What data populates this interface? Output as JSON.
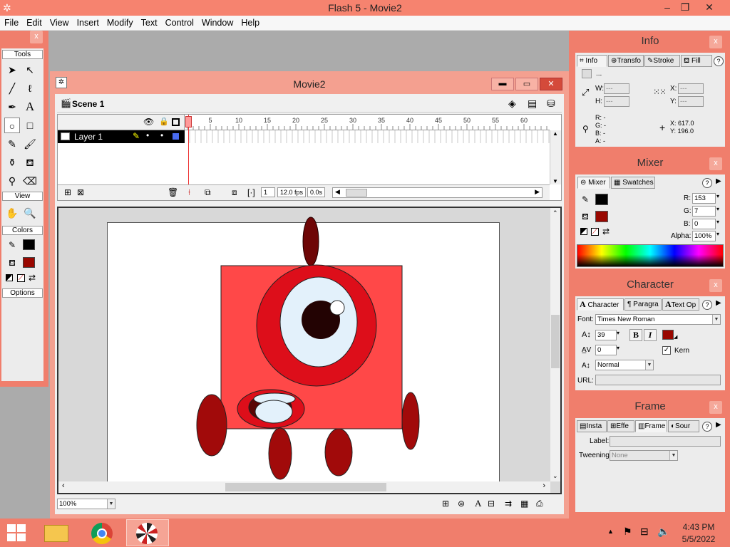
{
  "window": {
    "title": "Flash 5 - Movie2"
  },
  "menu": [
    "File",
    "Edit",
    "View",
    "Insert",
    "Modify",
    "Text",
    "Control",
    "Window",
    "Help"
  ],
  "tools": {
    "title": "Tools",
    "view_label": "View",
    "colors_label": "Colors",
    "options_label": "Options"
  },
  "movie": {
    "title": "Movie2",
    "scene": "Scene 1",
    "layer": "Layer 1",
    "ruler": [
      "1",
      "5",
      "10",
      "15",
      "20",
      "25",
      "30",
      "35",
      "40",
      "45",
      "50",
      "55",
      "60"
    ],
    "frame": "1",
    "fps": "12.0 fps",
    "time": "0.0s",
    "zoom": "100%"
  },
  "info_panel": {
    "title": "Info",
    "tabs": [
      "Info",
      "Transfo",
      "Stroke",
      "Fill"
    ],
    "w_label": "W:",
    "w_value": "---",
    "h_label": "H:",
    "h_value": "---",
    "x_label": "X:",
    "x_value": "---",
    "y_label": "Y:",
    "y_value": "---",
    "r_line": "R: -",
    "g_line": "G: -",
    "b_line": "B: -",
    "a_line": "A: -",
    "cursor_x": "X:  617.0",
    "cursor_y": "Y:  196.0"
  },
  "mixer_panel": {
    "title": "Mixer",
    "tabs": [
      "Mixer",
      "Swatches"
    ],
    "r_label": "R:",
    "r_value": "153",
    "g_label": "G:",
    "g_value": "7",
    "b_label": "B:",
    "b_value": "0",
    "alpha_label": "Alpha:",
    "alpha_value": "100%"
  },
  "character_panel": {
    "title": "Character",
    "tabs": [
      "Character",
      "Paragra",
      "Text Op"
    ],
    "font_label": "Font:",
    "font_value": "Times New Roman",
    "size_value": "39",
    "bold": "B",
    "italic": "I",
    "tracking_value": "0",
    "kern_label": "Kern",
    "baseline_value": "Normal",
    "url_label": "URL:"
  },
  "frame_panel": {
    "title": "Frame",
    "tabs": [
      "Insta",
      "Effe",
      "Frame",
      "Sour"
    ],
    "label_label": "Label:",
    "tweening_label": "Tweening:",
    "tweening_value": "None"
  },
  "taskbar": {
    "time": "4:43 PM",
    "date": "5/5/2022"
  },
  "colors": {
    "panel": "#f07e6c",
    "stage_bg": "#ffffff",
    "fill_color": "#990700",
    "body_red": "#ff4848",
    "eye_ring": "#dd0e1a",
    "eye_white": "#e3f1fb",
    "pupil": "#230303",
    "limb": "#a10a0a",
    "antenna": "#6e0606"
  }
}
